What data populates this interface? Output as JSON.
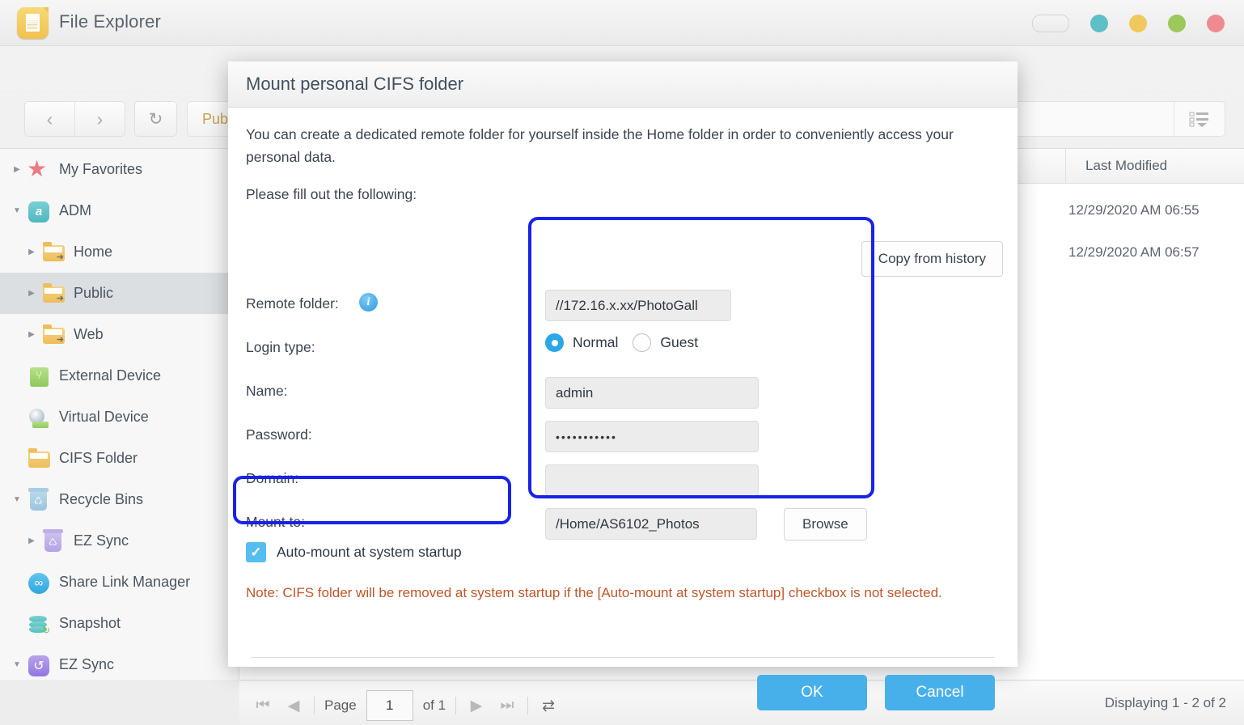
{
  "app": {
    "title": "File Explorer",
    "icon": "document-icon",
    "window_controls": [
      {
        "name": "pill-control",
        "color": "#f2f2f2"
      },
      {
        "name": "teal-dot",
        "color": "#5ebfc6"
      },
      {
        "name": "yellow-dot",
        "color": "#f0c95e"
      },
      {
        "name": "green-dot",
        "color": "#9dc85b"
      },
      {
        "name": "red-dot",
        "color": "#ef8b90"
      }
    ]
  },
  "toolbar": {
    "back": "‹",
    "forward": "›",
    "refresh": "↻",
    "breadcrumb": "Public",
    "breadcrumb_sep": "›",
    "upload": "↑",
    "upload_caret": "⌄",
    "new_folder": "⊞",
    "move_folder": "→",
    "gear": "⚙",
    "list_view": "☰",
    "list_caret": "⌄",
    "search_view": "☰"
  },
  "sidebar": {
    "items": [
      {
        "label": "My Favorites",
        "icon": "star-icon",
        "arrow": "right",
        "level": 0,
        "selected": false
      },
      {
        "label": "ADM",
        "icon": "adm-icon",
        "arrow": "down",
        "level": 0,
        "selected": false
      },
      {
        "label": "Home",
        "icon": "folder-shared-icon",
        "arrow": "right",
        "level": 1,
        "selected": false
      },
      {
        "label": "Public",
        "icon": "folder-shared-icon",
        "arrow": "right",
        "level": 1,
        "selected": true
      },
      {
        "label": "Web",
        "icon": "folder-shared-icon",
        "arrow": "right",
        "level": 1,
        "selected": false
      },
      {
        "label": "External Device",
        "icon": "usb-device-icon",
        "arrow": "none",
        "level": 0,
        "selected": false
      },
      {
        "label": "Virtual Device",
        "icon": "disc-device-icon",
        "arrow": "none",
        "level": 0,
        "selected": false
      },
      {
        "label": "CIFS Folder",
        "icon": "folder-icon",
        "arrow": "none",
        "level": 0,
        "selected": false
      },
      {
        "label": "Recycle Bins",
        "icon": "recycle-bin-icon",
        "arrow": "down",
        "level": 0,
        "selected": false
      },
      {
        "label": "EZ Sync",
        "icon": "recycle-bin-purple-icon",
        "arrow": "right",
        "level": 1,
        "selected": false
      },
      {
        "label": "Share Link Manager",
        "icon": "share-icon",
        "arrow": "none",
        "level": 0,
        "selected": false
      },
      {
        "label": "Snapshot",
        "icon": "snapshot-icon",
        "arrow": "none",
        "level": 0,
        "selected": false
      },
      {
        "label": "EZ Sync",
        "icon": "ez-sync-icon",
        "arrow": "down",
        "level": 0,
        "selected": false
      }
    ]
  },
  "filelist": {
    "column_header": "Last Modified",
    "rows": [
      {
        "last_modified": "12/29/2020 AM 06:55"
      },
      {
        "last_modified": "12/29/2020 AM 06:57"
      }
    ]
  },
  "statusbar": {
    "first_page": "⏮",
    "prev_page": "◀",
    "page_label": "Page",
    "page_value": "1",
    "of_label": "of 1",
    "next_page": "▶",
    "last_page": "⏭",
    "refresh_icon": "⇄",
    "displaying": "Displaying 1 - 2 of 2"
  },
  "dialog": {
    "title": "Mount personal CIFS folder",
    "intro": "You can create a dedicated remote folder for yourself inside the Home folder in order to conveniently access your personal data.",
    "fill_out": "Please fill out the following:",
    "copy_from_history": "Copy from history",
    "fields": [
      {
        "label": "Remote folder:",
        "value": "//172.16.x.xx/PhotoGall",
        "type": "text",
        "info": true
      },
      {
        "label": "Login type:",
        "type": "radio"
      },
      {
        "label": "Name:",
        "value": "admin",
        "type": "text"
      },
      {
        "label": "Password:",
        "value": "•••••••••••",
        "type": "password"
      },
      {
        "label": "Domain:",
        "value": "",
        "type": "text"
      },
      {
        "label": "Mount to:",
        "value": "/Home/AS6102_Photos",
        "type": "text",
        "button": "Browse"
      }
    ],
    "login_types": [
      {
        "label": "Normal",
        "selected": true
      },
      {
        "label": "Guest",
        "selected": false
      }
    ],
    "browse_label": "Browse",
    "info_glyph": "i",
    "checkbox": {
      "label": "Auto-mount at system startup",
      "checked": true,
      "glyph": "✓"
    },
    "note": "Note: CIFS folder will be removed at system startup if the [Auto-mount at system startup] checkbox is not selected.",
    "ok_label": "OK",
    "cancel_label": "Cancel"
  },
  "annotations": {
    "accent_color": "#1822e8",
    "boxes": [
      "fields-group-highlight",
      "auto-mount-checkbox-highlight"
    ]
  }
}
